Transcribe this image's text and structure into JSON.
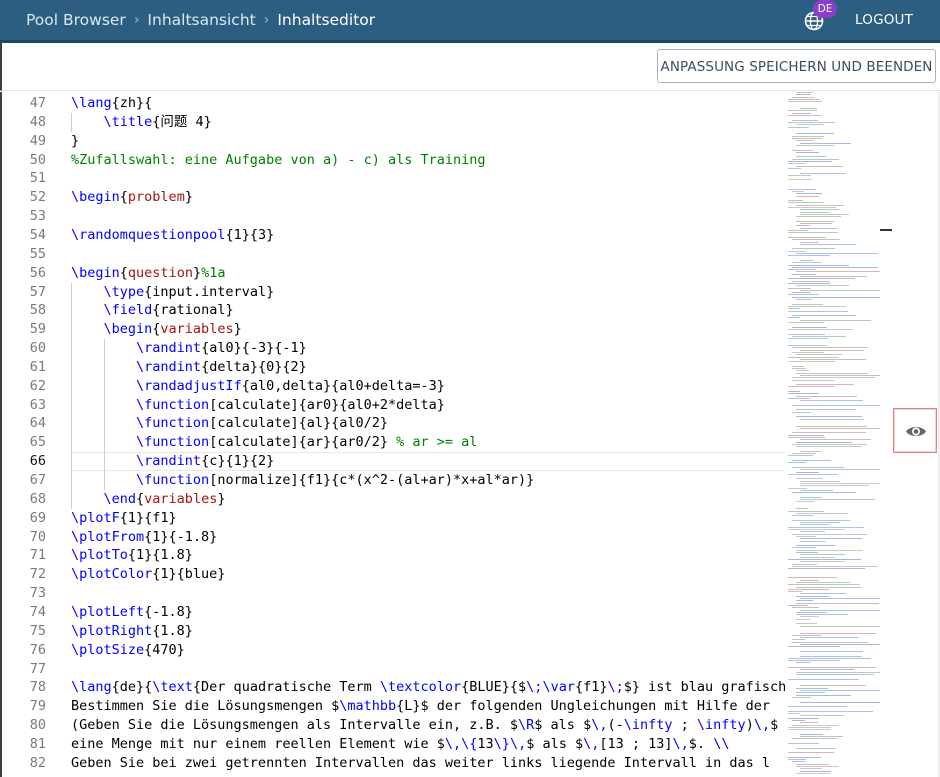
{
  "header": {
    "breadcrumb": [
      "Pool Browser",
      "Inhaltsansicht",
      "Inhaltseditor"
    ],
    "lang_badge": "DE",
    "logout_label": "LOGOUT",
    "bg_color": "#2c5e82",
    "badge_color": "#8b3fc8"
  },
  "toolbar": {
    "save_label": "ANPASSUNG SPEICHERN UND BEENDEN"
  },
  "editor": {
    "active_line": 66,
    "lines": [
      {
        "n": "47",
        "text": "\\lang{zh}{"
      },
      {
        "n": "48",
        "text": "    \\title{问题 4}"
      },
      {
        "n": "49",
        "text": "}"
      },
      {
        "n": "50",
        "text": "%Zufallswahl: eine Aufgabe von a) - c) als Training"
      },
      {
        "n": "51",
        "text": ""
      },
      {
        "n": "52",
        "text": "\\begin{problem}"
      },
      {
        "n": "53",
        "text": ""
      },
      {
        "n": "54",
        "text": "\\randomquestionpool{1}{3}"
      },
      {
        "n": "55",
        "text": ""
      },
      {
        "n": "56",
        "text": "\\begin{question}%1a"
      },
      {
        "n": "57",
        "text": "    \\type{input.interval}"
      },
      {
        "n": "58",
        "text": "    \\field{rational}"
      },
      {
        "n": "59",
        "text": "    \\begin{variables}"
      },
      {
        "n": "60",
        "text": "        \\randint{al0}{-3}{-1}"
      },
      {
        "n": "61",
        "text": "        \\randint{delta}{0}{2}"
      },
      {
        "n": "62",
        "text": "        \\randadjustIf{al0,delta}{al0+delta=-3}"
      },
      {
        "n": "63",
        "text": "        \\function[calculate]{ar0}{al0+2*delta}"
      },
      {
        "n": "64",
        "text": "        \\function[calculate]{al}{al0/2}"
      },
      {
        "n": "65",
        "text": "        \\function[calculate]{ar}{ar0/2} % ar >= al"
      },
      {
        "n": "66",
        "text": "        \\randint{c}{1}{2}"
      },
      {
        "n": "67",
        "text": "        \\function[normalize]{f1}{c*(x^2-(al+ar)*x+al*ar)}"
      },
      {
        "n": "68",
        "text": "    \\end{variables}"
      },
      {
        "n": "69",
        "text": "\\plotF{1}{f1}"
      },
      {
        "n": "70",
        "text": "\\plotFrom{1}{-1.8}"
      },
      {
        "n": "71",
        "text": "\\plotTo{1}{1.8}"
      },
      {
        "n": "72",
        "text": "\\plotColor{1}{blue}"
      },
      {
        "n": "73",
        "text": ""
      },
      {
        "n": "74",
        "text": "\\plotLeft{-1.8}"
      },
      {
        "n": "75",
        "text": "\\plotRight{1.8}"
      },
      {
        "n": "76",
        "text": "\\plotSize{470}"
      },
      {
        "n": "77",
        "text": ""
      },
      {
        "n": "78",
        "text": "\\lang{de}{\\text{Der quadratische Term \\textcolor{BLUE}{$\\;\\var{f1}\\;$} ist blau grafisch"
      },
      {
        "n": "79",
        "text": "Bestimmen Sie die Lösungsmengen $\\mathbb{L}$ der folgenden Ungleichungen mit Hilfe der"
      },
      {
        "n": "80",
        "text": "(Geben Sie die Lösungsmengen als Intervalle ein, z.B. $\\R$ als $\\,(-\\infty ; \\infty)\\,$"
      },
      {
        "n": "81",
        "text": "eine Menge mit nur einem reellen Element wie $\\,\\{13\\}\\,$ als $\\,[13 ; 13]\\,$. \\\\"
      },
      {
        "n": "82",
        "text": "Geben Sie bei zwei getrennten Intervallen das weiter links liegende Intervall in das l"
      }
    ]
  },
  "eye_button": {
    "icon": "eye-icon"
  },
  "language_icon": "globe-icon"
}
